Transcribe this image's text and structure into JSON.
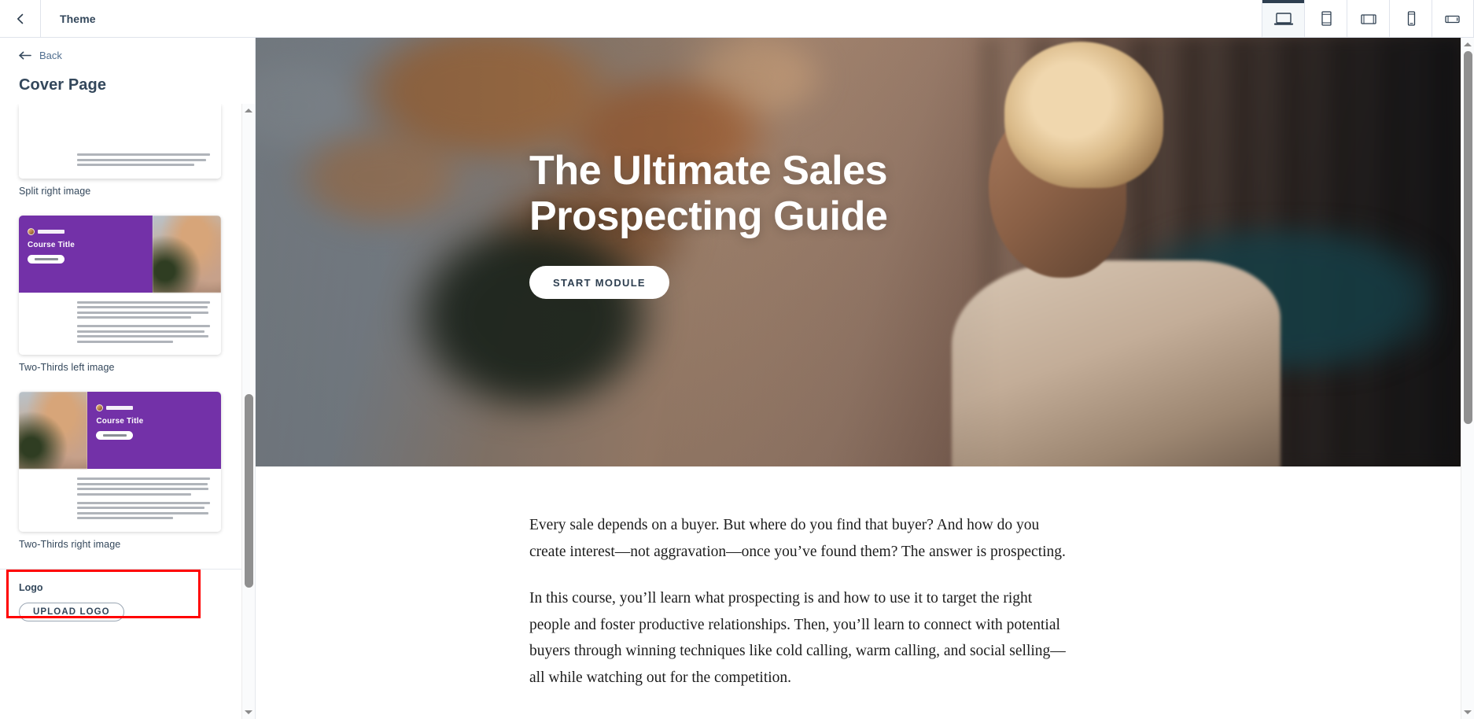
{
  "header": {
    "title": "Theme",
    "back_icon": "chevron-left-icon",
    "devices": [
      {
        "name": "desktop",
        "icon": "laptop-icon",
        "active": true
      },
      {
        "name": "tablet-portrait",
        "icon": "tablet-portrait-icon",
        "active": false
      },
      {
        "name": "tablet-landscape",
        "icon": "tablet-landscape-icon",
        "active": false
      },
      {
        "name": "mobile-portrait",
        "icon": "mobile-portrait-icon",
        "active": false
      },
      {
        "name": "mobile-landscape",
        "icon": "mobile-landscape-icon",
        "active": false
      }
    ]
  },
  "sidebar": {
    "back_label": "Back",
    "back_icon": "arrow-left-icon",
    "panel_title": "Cover Page",
    "layouts": [
      {
        "label": "Split right image",
        "variant": "split-right",
        "clipped": true
      },
      {
        "label": "Two-Thirds left image",
        "variant": "two-thirds-left",
        "clipped": false
      },
      {
        "label": "Two-Thirds right image",
        "variant": "two-thirds-right",
        "clipped": false
      }
    ],
    "thumb_course_title": "Course Title",
    "logo": {
      "label": "Logo",
      "upload_button": "UPLOAD LOGO",
      "highlight_color": "#ff0000"
    }
  },
  "preview": {
    "hero": {
      "title": "The Ultimate Sales\nProspecting Guide",
      "cta_label": "START MODULE",
      "image_description": "blurred city street with woman on phone"
    },
    "article": {
      "paragraphs": [
        "Every sale depends on a buyer. But where do you find that buyer? And how do you create interest—not aggravation—once you’ve found them? The answer is prospecting.",
        "In this course, you’ll learn what prospecting is and how to use it to target the right people and foster productive relationships. Then, you’ll learn to connect with potential buyers through winning techniques like cold calling, warm calling, and social selling—all while watching out for the competition."
      ]
    }
  },
  "theme": {
    "brand_purple": "#7331a8",
    "text_dark": "#33475b",
    "text_muted": "#516f90",
    "border": "#dfe3eb",
    "accent_active": "#2e3f50"
  }
}
